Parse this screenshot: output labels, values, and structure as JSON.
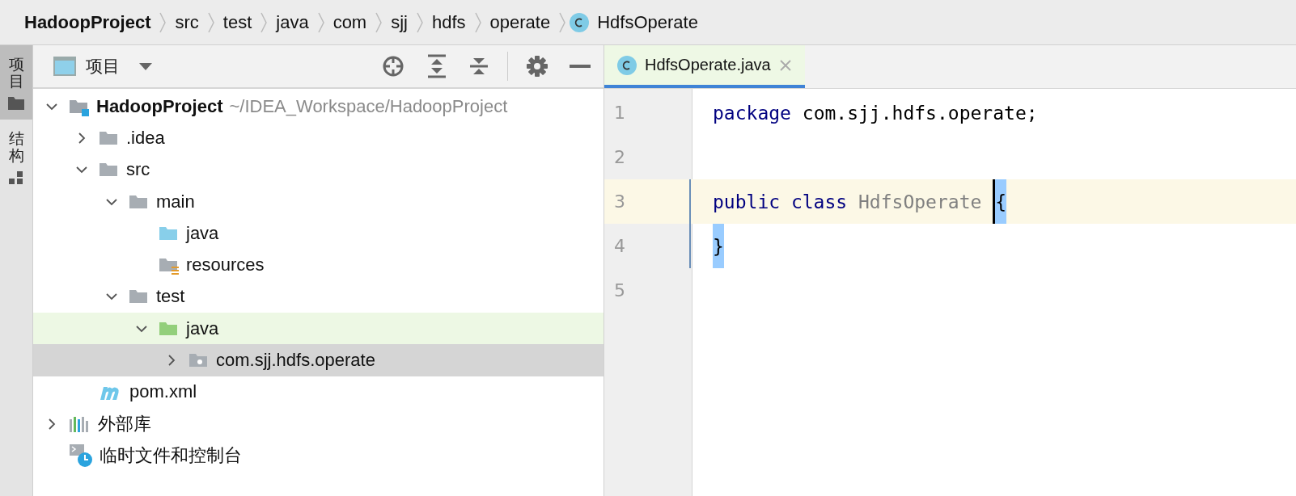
{
  "breadcrumbs": [
    {
      "label": "HadoopProject",
      "kind": "project"
    },
    {
      "label": "src",
      "kind": "folder"
    },
    {
      "label": "test",
      "kind": "folder"
    },
    {
      "label": "java",
      "kind": "folder"
    },
    {
      "label": "com",
      "kind": "folder"
    },
    {
      "label": "sjj",
      "kind": "folder"
    },
    {
      "label": "hdfs",
      "kind": "folder"
    },
    {
      "label": "operate",
      "kind": "folder"
    },
    {
      "label": "HdfsOperate",
      "kind": "class"
    }
  ],
  "side_tabs": [
    {
      "label": "项目",
      "kind": "folder",
      "selected": true
    },
    {
      "label": "结构",
      "kind": "structure",
      "selected": false
    }
  ],
  "project_panel": {
    "title": "项目",
    "tree": [
      {
        "label": "HadoopProject",
        "kind": "project",
        "path": "~/IDEA_Workspace/HadoopProject",
        "expanded": true,
        "selected": false,
        "highlighted": false,
        "children": [
          {
            "label": ".idea",
            "kind": "folder",
            "expanded": false,
            "selected": false,
            "highlighted": false
          },
          {
            "label": "src",
            "kind": "folder",
            "expanded": true,
            "selected": false,
            "highlighted": false,
            "children": [
              {
                "label": "main",
                "kind": "folder",
                "expanded": true,
                "selected": false,
                "highlighted": false,
                "children": [
                  {
                    "label": "java",
                    "kind": "source",
                    "selected": false,
                    "highlighted": false
                  },
                  {
                    "label": "resources",
                    "kind": "resources",
                    "selected": false,
                    "highlighted": false
                  }
                ]
              },
              {
                "label": "test",
                "kind": "folder",
                "expanded": true,
                "selected": false,
                "highlighted": false,
                "children": [
                  {
                    "label": "java",
                    "kind": "test",
                    "expanded": true,
                    "selected": false,
                    "highlighted": true,
                    "children": [
                      {
                        "label": "com.sjj.hdfs.operate",
                        "kind": "package",
                        "expanded": false,
                        "selected": true
                      }
                    ]
                  }
                ]
              }
            ]
          },
          {
            "label": "pom.xml",
            "kind": "maven",
            "selected": false,
            "highlighted": false
          }
        ]
      },
      {
        "label": "外部库",
        "kind": "library",
        "expanded": false,
        "selected": false,
        "highlighted": false
      },
      {
        "label": "临时文件和控制台",
        "kind": "scratches",
        "selected": false,
        "highlighted": false
      }
    ]
  },
  "editor": {
    "tabs": [
      {
        "label": "HdfsOperate.java",
        "selected": true
      }
    ],
    "lines": [
      {
        "number": "1",
        "current": false,
        "tokens": [
          {
            "text": "package",
            "kind": "keyword"
          },
          {
            "text": " com.sjj.hdfs.operate;",
            "kind": "plain"
          }
        ]
      },
      {
        "number": "2",
        "current": false
      },
      {
        "number": "3",
        "current": true,
        "tokens": [
          {
            "text": "public class",
            "kind": "keyword"
          },
          {
            "text": " HdfsOperate ",
            "kind": "unused"
          },
          {
            "text": "{",
            "kind": "plain",
            "matched": true,
            "caret": true
          }
        ]
      },
      {
        "number": "4",
        "current": false,
        "tokens": [
          {
            "text": "}",
            "kind": "plain",
            "matched": true
          }
        ]
      },
      {
        "number": "5",
        "current": false
      }
    ]
  }
}
